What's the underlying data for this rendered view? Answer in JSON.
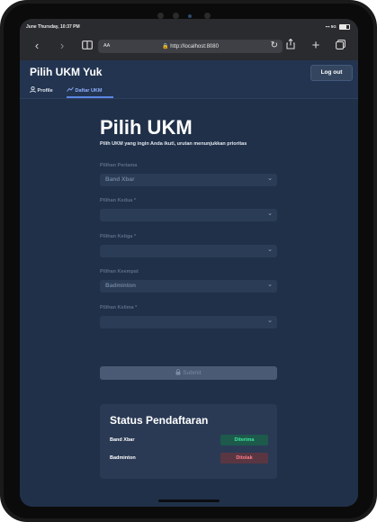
{
  "status_bar": {
    "time": "June Thursday, 10:37 PM",
    "signal": "5G"
  },
  "browser": {
    "reader_label": "AA",
    "url": "http://localhost:8080"
  },
  "app": {
    "title": "Pilih UKM Yuk",
    "logout_label": "Log out",
    "tabs": [
      {
        "label": "Profile"
      },
      {
        "label": "Daftar UKM"
      }
    ]
  },
  "main": {
    "heading": "Pilih UKM",
    "subtitle": "Pilih UKM yang ingin Anda ikuti, urutan menunjukkan prioritas",
    "fields": [
      {
        "label": "Pilihan Pertama",
        "value": "Band Xbar"
      },
      {
        "label": "Pilihan Kedua *",
        "value": ""
      },
      {
        "label": "Pilihan Ketiga *",
        "value": ""
      },
      {
        "label": "Pilihan Keempat",
        "value": "Badminton"
      },
      {
        "label": "Pilihan Kelima *",
        "value": ""
      }
    ],
    "submit_label": "Submit"
  },
  "status_card": {
    "title": "Status Pendaftaran",
    "rows": [
      {
        "name": "Band Xbar",
        "status": "Diterima",
        "status_color": "#3ee69b"
      },
      {
        "name": "Badminton",
        "status": "Ditolak",
        "status_color": "#ff7f89"
      }
    ]
  },
  "colors": {
    "page_bg": "#203049",
    "accent": "#5b86e5"
  }
}
